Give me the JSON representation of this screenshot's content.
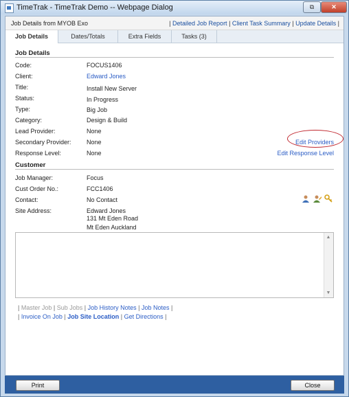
{
  "window": {
    "title": "TimeTrak - TimeTrak Demo -- Webpage Dialog",
    "restore_glyph": "⧉",
    "close_glyph": "✕"
  },
  "header": {
    "left_text": "Job Details from MYOB Exo",
    "links": [
      "Detailed Job Report",
      "Client Task Summary",
      "Update Details"
    ]
  },
  "tabs": [
    {
      "label": "Job Details",
      "active": true
    },
    {
      "label": "Dates/Totals",
      "active": false
    },
    {
      "label": "Extra Fields",
      "active": false
    },
    {
      "label": "Tasks (3)",
      "active": false
    }
  ],
  "job_details": {
    "section_title": "Job Details",
    "code": {
      "label": "Code:",
      "value": "FOCUS1406"
    },
    "client": {
      "label": "Client:",
      "value": "Edward Jones"
    },
    "title": {
      "label": "Title:",
      "value": "Install New Server"
    },
    "status": {
      "label": "Status:",
      "value": "In Progress"
    },
    "type": {
      "label": "Type:",
      "value": "Big Job"
    },
    "category": {
      "label": "Category:",
      "value": "Design & Build"
    },
    "lead_provider": {
      "label": "Lead Provider:",
      "value": "None"
    },
    "secondary_provider": {
      "label": "Secondary Provider:",
      "value": "None",
      "action": "Edit Providers"
    },
    "response_level": {
      "label": "Response Level:",
      "value": "None",
      "action": "Edit Response Level"
    }
  },
  "customer": {
    "section_title": "Customer",
    "job_manager": {
      "label": "Job Manager:",
      "value": "Focus"
    },
    "cust_order_no": {
      "label": "Cust Order No.:",
      "value": "FCC1406"
    },
    "contact": {
      "label": "Contact:",
      "value": "No Contact"
    },
    "site_address": {
      "label": "Site Address:",
      "lines": [
        "Edward Jones",
        "131 Mt Eden Road",
        "Mt Eden Auckland"
      ]
    }
  },
  "nav_links": {
    "row1": [
      "Master Job",
      "Sub Jobs",
      "Job History Notes",
      "Job Notes"
    ],
    "row2": [
      "Invoice On Job",
      "Job Site Location",
      "Get Directions"
    ]
  },
  "footer": {
    "print_label": "Print",
    "close_label": "Close"
  },
  "colors": {
    "link": "#2a5cc5",
    "footer_bg": "#2e5fa1",
    "highlight_circle": "#c0262d"
  }
}
